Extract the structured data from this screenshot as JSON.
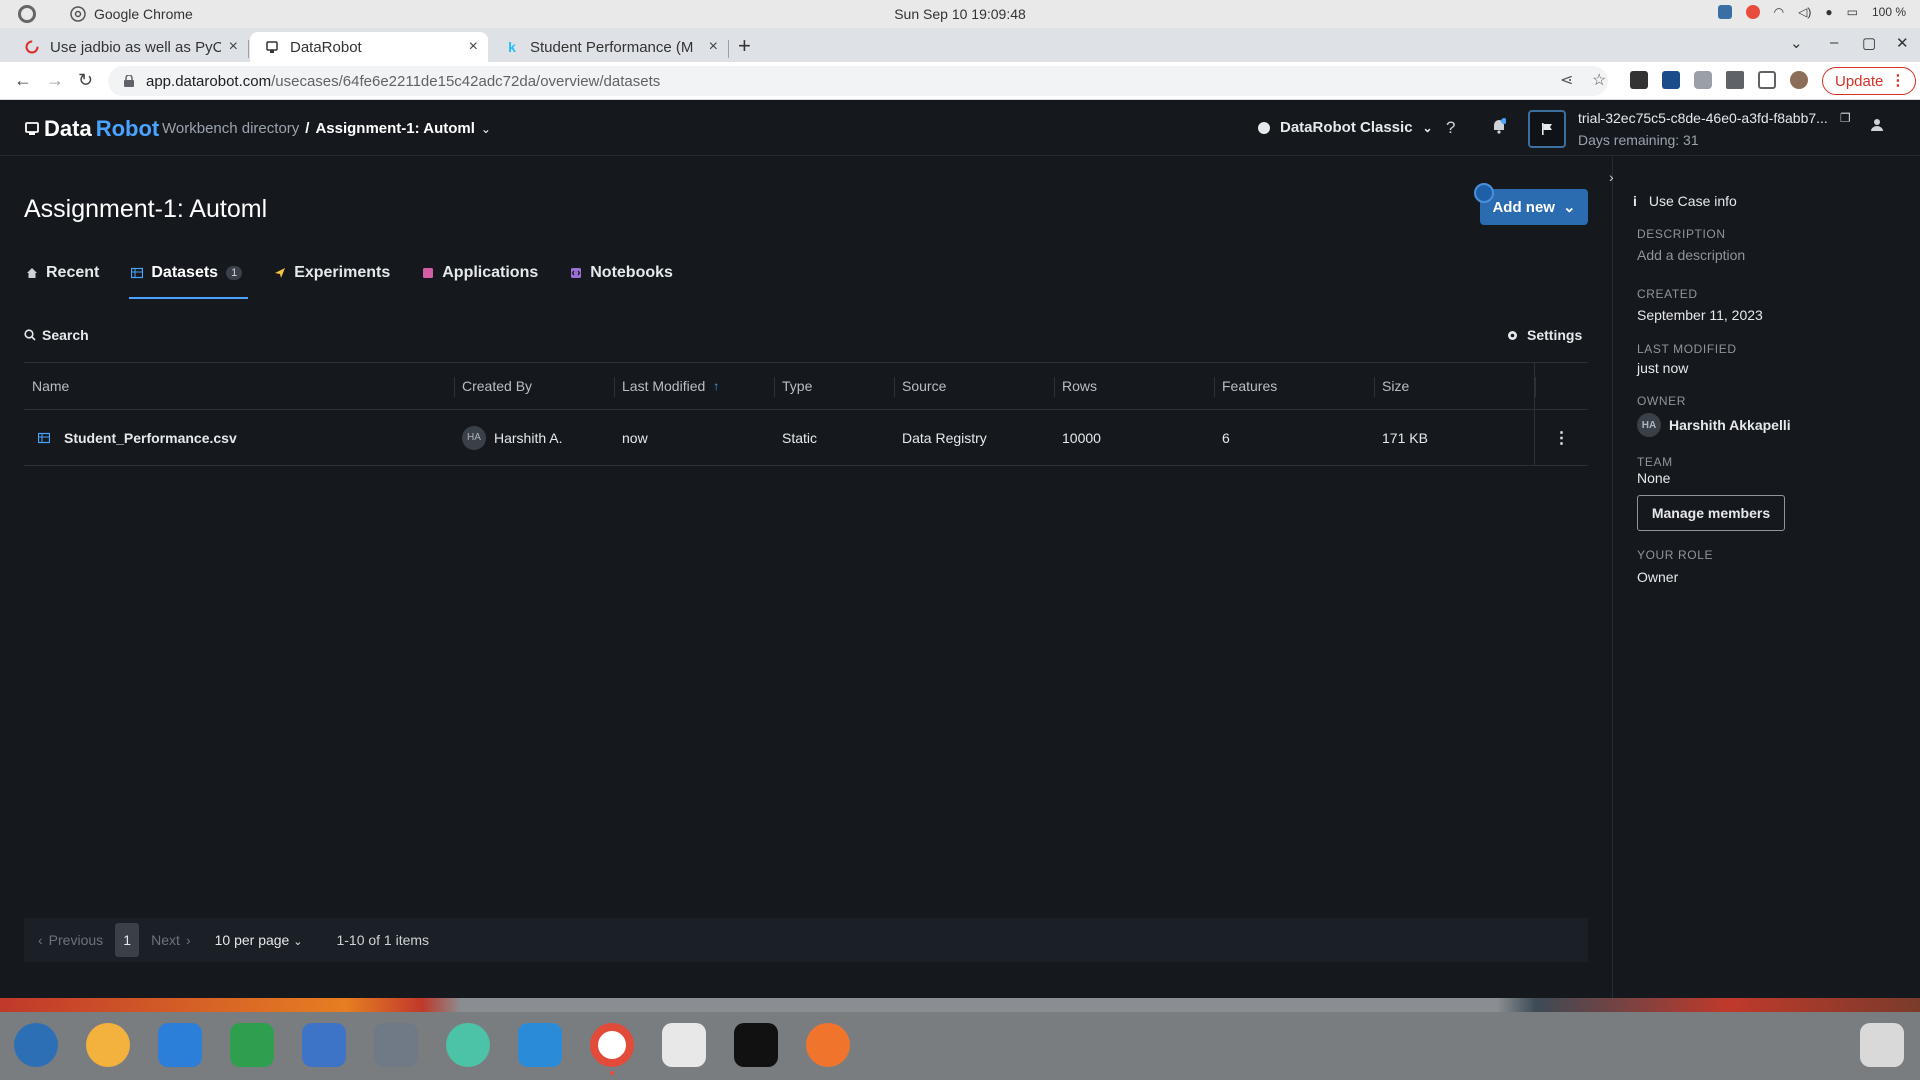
{
  "os": {
    "app_name": "Google Chrome",
    "clock": "Sun Sep 10  19:09:48",
    "battery": "100 %"
  },
  "browser": {
    "tabs": [
      {
        "title": "Use jadbio as well as PyCa",
        "favicon": "loading-spinner-icon"
      },
      {
        "title": "DataRobot",
        "favicon": "datarobot-icon"
      },
      {
        "title": "Student Performance (M",
        "favicon": "kaggle-icon"
      }
    ],
    "url_host": "app.datarobot.com",
    "url_path": "/usecases/64fe6e2211de15c42adc72da/overview/datasets",
    "update_label": "Update"
  },
  "header": {
    "logo_data": "Data",
    "logo_robot": "Robot",
    "breadcrumb_root": "Workbench directory",
    "breadcrumb_sep": "/",
    "breadcrumb_current": "Assignment-1: Automl",
    "classic_label": "DataRobot Classic",
    "help_label": "?",
    "trial_name": "trial-32ec75c5-c8de-46e0-a3fd-f8abb7...",
    "days_remaining": "Days remaining: 31"
  },
  "main": {
    "title": "Assignment-1: Automl",
    "add_new_label": "Add new",
    "tabs": [
      {
        "label": "Recent",
        "icon": "home-icon"
      },
      {
        "label": "Datasets",
        "icon": "table-icon",
        "count": "1"
      },
      {
        "label": "Experiments",
        "icon": "experiment-icon"
      },
      {
        "label": "Applications",
        "icon": "app-icon"
      },
      {
        "label": "Notebooks",
        "icon": "notebook-icon"
      }
    ],
    "search_label": "Search",
    "settings_label": "Settings",
    "columns": [
      "Name",
      "Created By",
      "Last Modified",
      "Type",
      "Source",
      "Rows",
      "Features",
      "Size"
    ],
    "rows": [
      {
        "name": "Student_Performance.csv",
        "created_by_initials": "HA",
        "created_by": "Harshith A.",
        "last_modified": "now",
        "type": "Static",
        "source": "Data Registry",
        "rows": "10000",
        "features": "6",
        "size": "171 KB"
      }
    ],
    "pager": {
      "previous": "Previous",
      "page": "1",
      "next": "Next",
      "per_page": "10 per page",
      "items": "1-10 of 1 items"
    }
  },
  "panel": {
    "heading": "Use Case info",
    "description_label": "DESCRIPTION",
    "description_value": "Add a description",
    "created_label": "CREATED",
    "created_value": "September 11, 2023",
    "modified_label": "LAST MODIFIED",
    "modified_value": "just now",
    "owner_label": "OWNER",
    "owner_initials": "HA",
    "owner_value": "Harshith Akkapelli",
    "team_label": "TEAM",
    "team_value": "None",
    "manage_label": "Manage members",
    "role_label": "YOUR ROLE",
    "role_value": "Owner"
  },
  "colors": {
    "accent": "#4aa3ff",
    "primary_button": "#2b6cb0",
    "background": "#15191e"
  }
}
